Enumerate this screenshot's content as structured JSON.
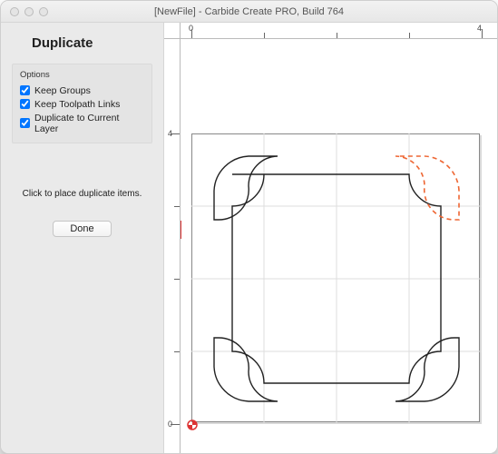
{
  "window": {
    "title": "[NewFile] - Carbide Create PRO, Build 764",
    "traffic": {
      "close": "#e4e4e4",
      "min": "#e4e4e4",
      "max": "#e4e4e4"
    }
  },
  "panel": {
    "title": "Duplicate",
    "options_caption": "Options",
    "options": [
      {
        "label": "Keep Groups",
        "checked": true
      },
      {
        "label": "Keep Toolpath Links",
        "checked": true
      },
      {
        "label": "Duplicate to Current Layer",
        "checked": true
      }
    ],
    "hint": "Click to place duplicate items.",
    "done_label": "Done"
  },
  "ruler": {
    "h": [
      "0",
      "4"
    ],
    "v": [
      "0",
      "4"
    ]
  },
  "colors": {
    "selected": "#ee6633",
    "stroke": "#222222",
    "grid": "#dddddd"
  }
}
